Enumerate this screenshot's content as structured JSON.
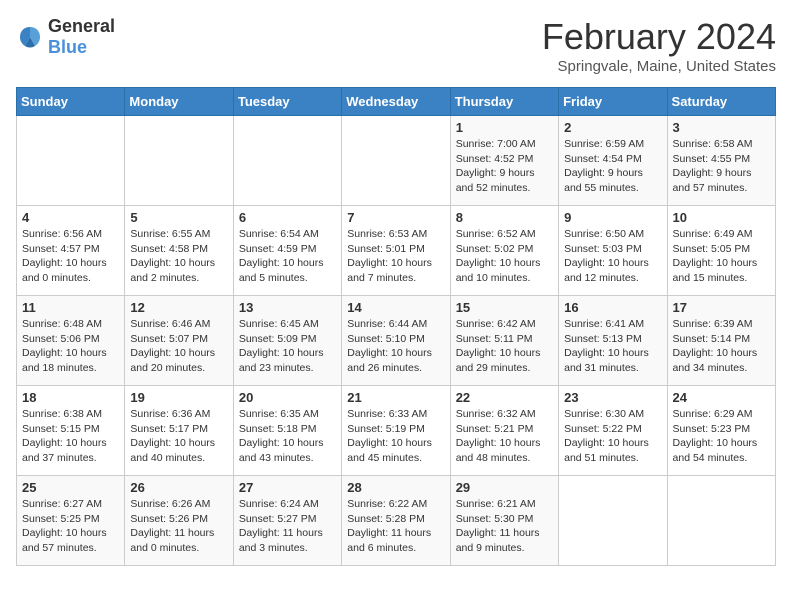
{
  "logo": {
    "text_general": "General",
    "text_blue": "Blue"
  },
  "title": "February 2024",
  "subtitle": "Springvale, Maine, United States",
  "days_of_week": [
    "Sunday",
    "Monday",
    "Tuesday",
    "Wednesday",
    "Thursday",
    "Friday",
    "Saturday"
  ],
  "weeks": [
    [
      {
        "day": "",
        "info": ""
      },
      {
        "day": "",
        "info": ""
      },
      {
        "day": "",
        "info": ""
      },
      {
        "day": "",
        "info": ""
      },
      {
        "day": "1",
        "info": "Sunrise: 7:00 AM\nSunset: 4:52 PM\nDaylight: 9 hours\nand 52 minutes."
      },
      {
        "day": "2",
        "info": "Sunrise: 6:59 AM\nSunset: 4:54 PM\nDaylight: 9 hours\nand 55 minutes."
      },
      {
        "day": "3",
        "info": "Sunrise: 6:58 AM\nSunset: 4:55 PM\nDaylight: 9 hours\nand 57 minutes."
      }
    ],
    [
      {
        "day": "4",
        "info": "Sunrise: 6:56 AM\nSunset: 4:57 PM\nDaylight: 10 hours\nand 0 minutes."
      },
      {
        "day": "5",
        "info": "Sunrise: 6:55 AM\nSunset: 4:58 PM\nDaylight: 10 hours\nand 2 minutes."
      },
      {
        "day": "6",
        "info": "Sunrise: 6:54 AM\nSunset: 4:59 PM\nDaylight: 10 hours\nand 5 minutes."
      },
      {
        "day": "7",
        "info": "Sunrise: 6:53 AM\nSunset: 5:01 PM\nDaylight: 10 hours\nand 7 minutes."
      },
      {
        "day": "8",
        "info": "Sunrise: 6:52 AM\nSunset: 5:02 PM\nDaylight: 10 hours\nand 10 minutes."
      },
      {
        "day": "9",
        "info": "Sunrise: 6:50 AM\nSunset: 5:03 PM\nDaylight: 10 hours\nand 12 minutes."
      },
      {
        "day": "10",
        "info": "Sunrise: 6:49 AM\nSunset: 5:05 PM\nDaylight: 10 hours\nand 15 minutes."
      }
    ],
    [
      {
        "day": "11",
        "info": "Sunrise: 6:48 AM\nSunset: 5:06 PM\nDaylight: 10 hours\nand 18 minutes."
      },
      {
        "day": "12",
        "info": "Sunrise: 6:46 AM\nSunset: 5:07 PM\nDaylight: 10 hours\nand 20 minutes."
      },
      {
        "day": "13",
        "info": "Sunrise: 6:45 AM\nSunset: 5:09 PM\nDaylight: 10 hours\nand 23 minutes."
      },
      {
        "day": "14",
        "info": "Sunrise: 6:44 AM\nSunset: 5:10 PM\nDaylight: 10 hours\nand 26 minutes."
      },
      {
        "day": "15",
        "info": "Sunrise: 6:42 AM\nSunset: 5:11 PM\nDaylight: 10 hours\nand 29 minutes."
      },
      {
        "day": "16",
        "info": "Sunrise: 6:41 AM\nSunset: 5:13 PM\nDaylight: 10 hours\nand 31 minutes."
      },
      {
        "day": "17",
        "info": "Sunrise: 6:39 AM\nSunset: 5:14 PM\nDaylight: 10 hours\nand 34 minutes."
      }
    ],
    [
      {
        "day": "18",
        "info": "Sunrise: 6:38 AM\nSunset: 5:15 PM\nDaylight: 10 hours\nand 37 minutes."
      },
      {
        "day": "19",
        "info": "Sunrise: 6:36 AM\nSunset: 5:17 PM\nDaylight: 10 hours\nand 40 minutes."
      },
      {
        "day": "20",
        "info": "Sunrise: 6:35 AM\nSunset: 5:18 PM\nDaylight: 10 hours\nand 43 minutes."
      },
      {
        "day": "21",
        "info": "Sunrise: 6:33 AM\nSunset: 5:19 PM\nDaylight: 10 hours\nand 45 minutes."
      },
      {
        "day": "22",
        "info": "Sunrise: 6:32 AM\nSunset: 5:21 PM\nDaylight: 10 hours\nand 48 minutes."
      },
      {
        "day": "23",
        "info": "Sunrise: 6:30 AM\nSunset: 5:22 PM\nDaylight: 10 hours\nand 51 minutes."
      },
      {
        "day": "24",
        "info": "Sunrise: 6:29 AM\nSunset: 5:23 PM\nDaylight: 10 hours\nand 54 minutes."
      }
    ],
    [
      {
        "day": "25",
        "info": "Sunrise: 6:27 AM\nSunset: 5:25 PM\nDaylight: 10 hours\nand 57 minutes."
      },
      {
        "day": "26",
        "info": "Sunrise: 6:26 AM\nSunset: 5:26 PM\nDaylight: 11 hours\nand 0 minutes."
      },
      {
        "day": "27",
        "info": "Sunrise: 6:24 AM\nSunset: 5:27 PM\nDaylight: 11 hours\nand 3 minutes."
      },
      {
        "day": "28",
        "info": "Sunrise: 6:22 AM\nSunset: 5:28 PM\nDaylight: 11 hours\nand 6 minutes."
      },
      {
        "day": "29",
        "info": "Sunrise: 6:21 AM\nSunset: 5:30 PM\nDaylight: 11 hours\nand 9 minutes."
      },
      {
        "day": "",
        "info": ""
      },
      {
        "day": "",
        "info": ""
      }
    ]
  ]
}
